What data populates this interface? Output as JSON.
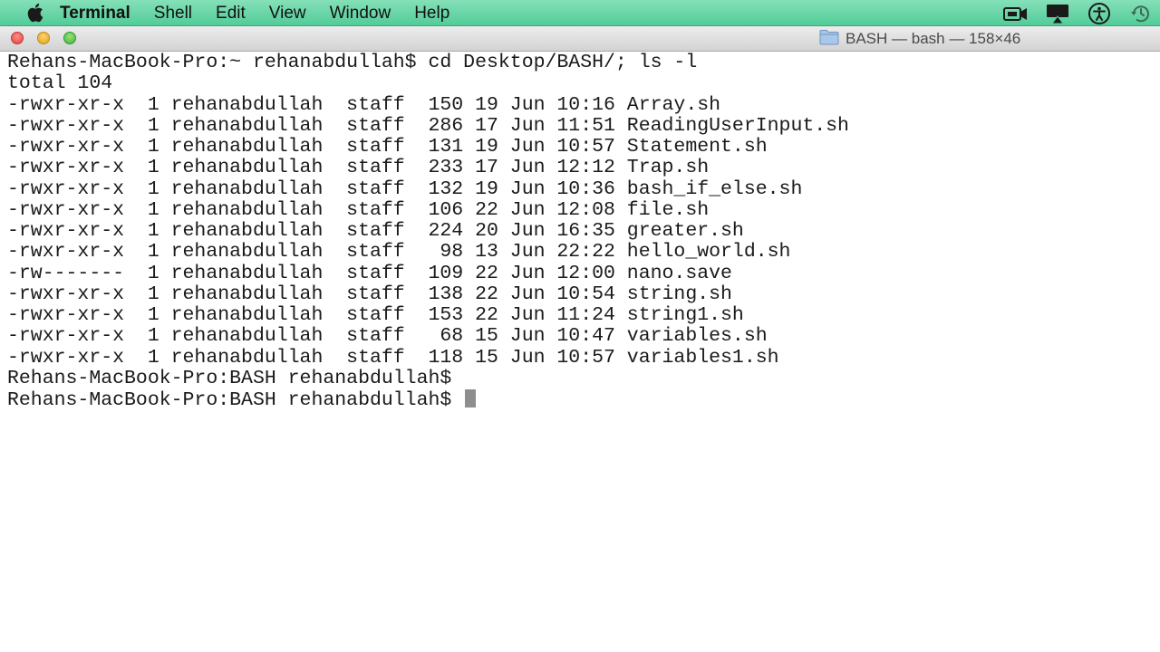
{
  "menubar": {
    "app_name": "Terminal",
    "items": [
      "Shell",
      "Edit",
      "View",
      "Window",
      "Help"
    ],
    "right_icons": [
      "video-camera-icon",
      "airplay-icon",
      "accessibility-icon",
      "time-machine-icon"
    ]
  },
  "window": {
    "title": "BASH — bash — 158×46",
    "folder_icon": "folder-icon"
  },
  "terminal": {
    "command_line": "Rehans-MacBook-Pro:~ rehanabdullah$ cd Desktop/BASH/; ls -l",
    "total_line": "total 104",
    "listing": [
      "-rwxr-xr-x  1 rehanabdullah  staff  150 19 Jun 10:16 Array.sh",
      "-rwxr-xr-x  1 rehanabdullah  staff  286 17 Jun 11:51 ReadingUserInput.sh",
      "-rwxr-xr-x  1 rehanabdullah  staff  131 19 Jun 10:57 Statement.sh",
      "-rwxr-xr-x  1 rehanabdullah  staff  233 17 Jun 12:12 Trap.sh",
      "-rwxr-xr-x  1 rehanabdullah  staff  132 19 Jun 10:36 bash_if_else.sh",
      "-rwxr-xr-x  1 rehanabdullah  staff  106 22 Jun 12:08 file.sh",
      "-rwxr-xr-x  1 rehanabdullah  staff  224 20 Jun 16:35 greater.sh",
      "-rwxr-xr-x  1 rehanabdullah  staff   98 13 Jun 22:22 hello_world.sh",
      "-rw-------  1 rehanabdullah  staff  109 22 Jun 12:00 nano.save",
      "-rwxr-xr-x  1 rehanabdullah  staff  138 22 Jun 10:54 string.sh",
      "-rwxr-xr-x  1 rehanabdullah  staff  153 22 Jun 11:24 string1.sh",
      "-rwxr-xr-x  1 rehanabdullah  staff   68 15 Jun 10:47 variables.sh",
      "-rwxr-xr-x  1 rehanabdullah  staff  118 15 Jun 10:57 variables1.sh"
    ],
    "prompt_lines": [
      "Rehans-MacBook-Pro:BASH rehanabdullah$",
      "Rehans-MacBook-Pro:BASH rehanabdullah$ "
    ]
  }
}
